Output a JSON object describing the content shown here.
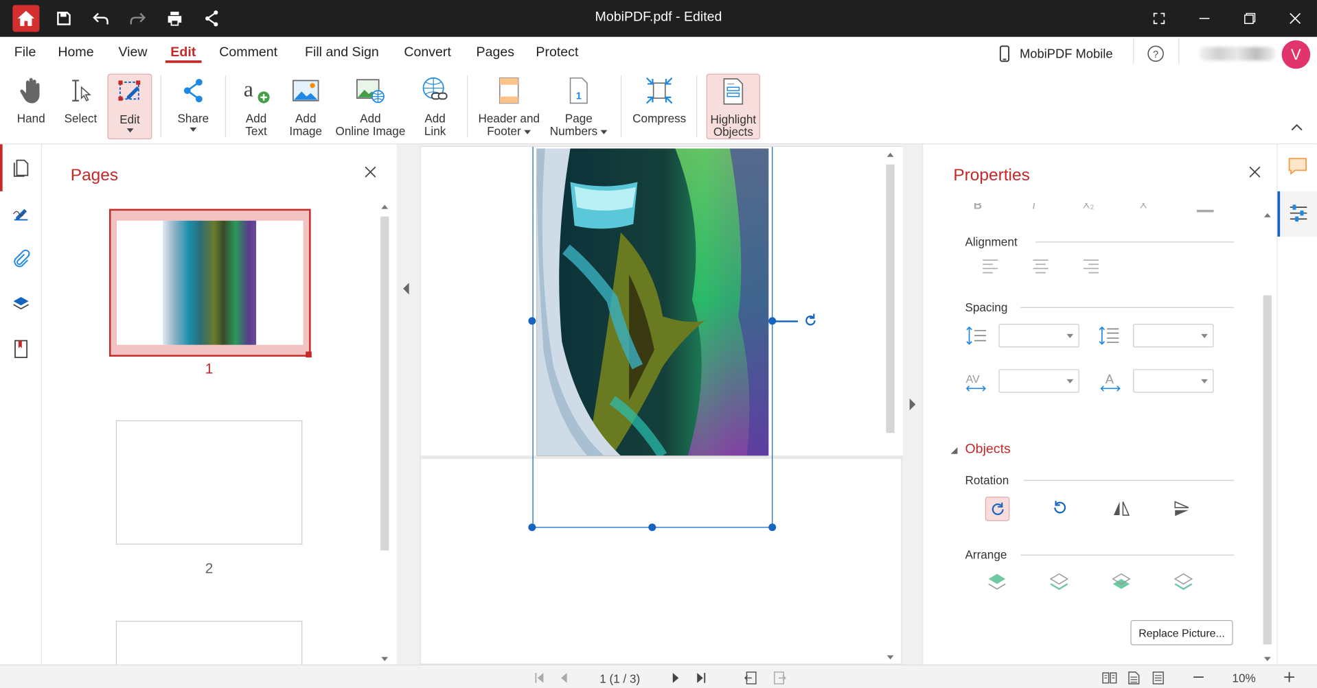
{
  "window": {
    "title": "MobiPDF.pdf - Edited"
  },
  "menu": {
    "items": [
      "File",
      "Home",
      "View",
      "Edit",
      "Comment",
      "Fill and Sign",
      "Convert",
      "Pages",
      "Protect"
    ],
    "active": "Edit",
    "mobile_label": "MobiPDF Mobile",
    "avatar_letter": "V"
  },
  "toolbar": {
    "hand": "Hand",
    "select": "Select",
    "edit": "Edit",
    "share": "Share",
    "add_text_1": "Add",
    "add_text_2": "Text",
    "add_image_1": "Add",
    "add_image_2": "Image",
    "add_online_1": "Add",
    "add_online_2": "Online Image",
    "add_link_1": "Add",
    "add_link_2": "Link",
    "header_1": "Header and",
    "header_2": "Footer",
    "pagenum_1": "Page",
    "pagenum_2": "Numbers",
    "compress": "Compress",
    "highlight_1": "Highlight",
    "highlight_2": "Objects"
  },
  "pages_panel": {
    "title": "Pages",
    "pages": [
      "1",
      "2"
    ]
  },
  "properties": {
    "title": "Properties",
    "alignment": "Alignment",
    "spacing": "Spacing",
    "objects": "Objects",
    "rotation": "Rotation",
    "arrange": "Arrange",
    "replace_button": "Replace Picture..."
  },
  "status": {
    "page_indicator": "1 (1 / 3)",
    "zoom": "10%"
  },
  "colors": {
    "accent": "#c62828",
    "titlebar": "#1f1f1f",
    "selection": "#1565c0"
  }
}
